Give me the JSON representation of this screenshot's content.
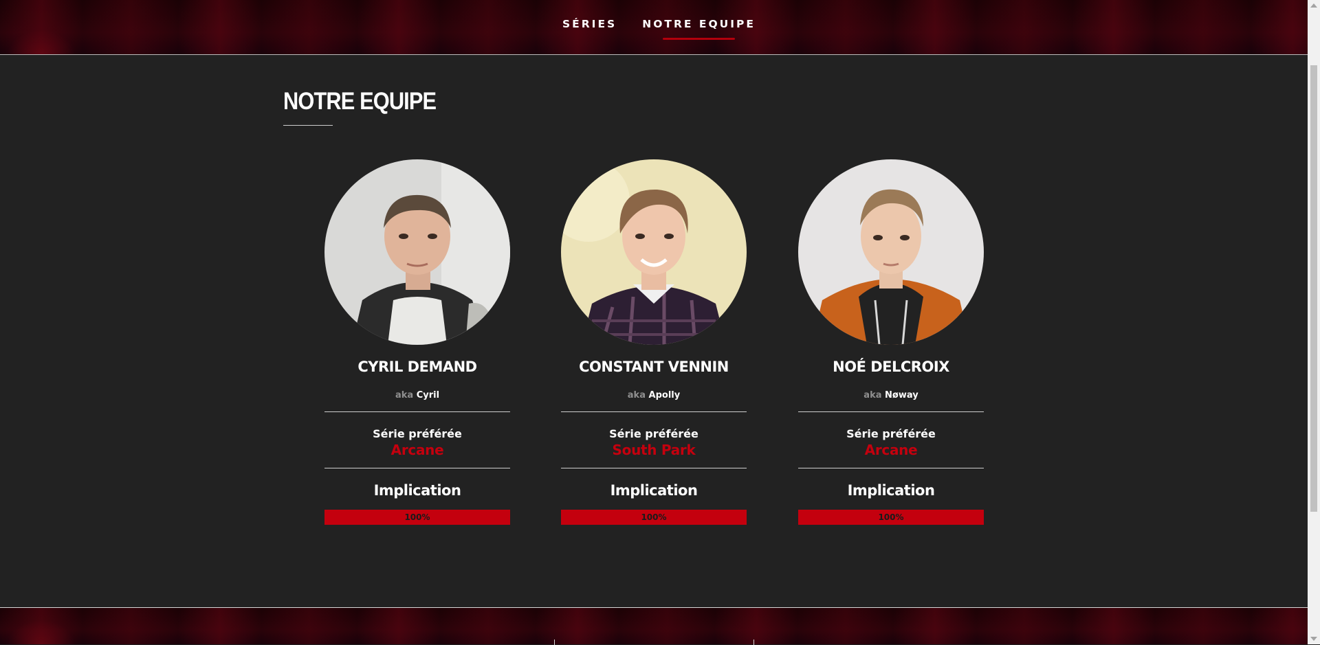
{
  "nav": {
    "items": [
      {
        "label": "SÉRIES",
        "active": false
      },
      {
        "label": "NOTRE EQUIPE",
        "active": true
      }
    ]
  },
  "section": {
    "title": "NOTRE EQUIPE"
  },
  "colors": {
    "accent": "#c4000e",
    "background": "#222222",
    "text": "#ffffff",
    "muted": "#8f8f8f"
  },
  "members": [
    {
      "name": "CYRIL DEMAND",
      "aka_prefix": "aka",
      "nickname": "Cyril",
      "favorite_label": "Série préférée",
      "favorite_series": "Arcane",
      "implication_label": "Implication",
      "implication_text": "100%",
      "implication": 1.0,
      "photo": "portrait-photo"
    },
    {
      "name": "CONSTANT VENNIN",
      "aka_prefix": "aka",
      "nickname": "Apolly",
      "favorite_label": "Série préférée",
      "favorite_series": "South Park",
      "implication_label": "Implication",
      "implication_text": "100%",
      "implication": 1.0,
      "photo": "portrait-photo"
    },
    {
      "name": "NOÉ DELCROIX",
      "aka_prefix": "aka",
      "nickname": "Nøway",
      "favorite_label": "Série préférée",
      "favorite_series": "Arcane",
      "implication_label": "Implication",
      "implication_text": "100%",
      "implication": 1.0,
      "photo": "portrait-photo"
    }
  ]
}
